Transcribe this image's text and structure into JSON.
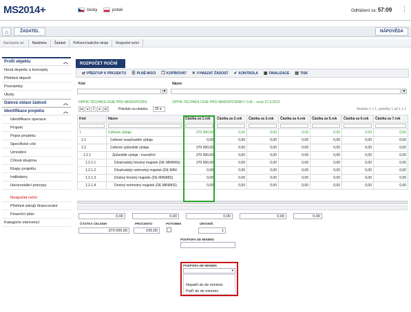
{
  "header": {
    "logo_main": "MS2014",
    "logo_plus": "+",
    "lang_cz": "česky",
    "lang_pl": "polski",
    "logout_label": "Odhlášení za:",
    "logout_time": "57:09"
  },
  "nav": {
    "applicant": "ŽADATEL",
    "help": "NÁPOVĚDA"
  },
  "breadcrumb": {
    "location_label": "Nacházíte se:",
    "items": [
      "Nástěnka",
      "Žadatel",
      "Pořízení balicího stroje",
      "Rozpočet roční"
    ]
  },
  "sidebar": {
    "h1": "Profil objektu",
    "items1": [
      "Nová depeše a koncepty",
      "Přehled depeší",
      "Poznámky",
      "Úkoly"
    ],
    "h2": "Datová oblast žádosti",
    "h3": "Identifikace projektu",
    "items3": [
      "Identifikace operace",
      "Projekt",
      "Popis projektu",
      "Specifické cíle",
      "Umístění",
      "Cílová skupina",
      "Etapy projektu",
      "Indikátory",
      "Horizontální principy"
    ],
    "active": "Rozpočet roční",
    "items4": [
      "Přehled zdrojů financování",
      "Finanční plán"
    ],
    "last": "Kategorie intervencí"
  },
  "main": {
    "tab": "ROZPOČET ROČNÍ",
    "toolbar": [
      "PŘESTUP K PROJEKTU",
      "PLNÉ MOCI",
      "KOPÍROVAT",
      "VYMAZAT ŽÁDOST",
      "KONTROLA",
      "FINALIZACE",
      "TISK"
    ],
    "col_kod": "Kód",
    "col_nazev": "Název",
    "prog_code": "OPPIK-TECHNOLOGIE PRO MIKROPODNI",
    "prog_name": "OPPIK-TECHNOLOGIE PRO MIKROPODNIKY O.M. - nový 27.9.2015",
    "pager_label": "Položek na stránku",
    "pager_value": "25",
    "pager_info": "Stránka 1 z 1, položky 1 až 1 z 1"
  },
  "table": {
    "headers": [
      "Kód",
      "Název",
      "Částka za 1.rok",
      "Částka za 2.rok",
      "Částka za 3.rok",
      "Částka za 4.rok",
      "Částka za 5.rok",
      "Částka za 6.rok",
      "Částka za 7.rok"
    ],
    "rows": [
      {
        "kod": "1",
        "nazev": "Celkové výdaje",
        "v": [
          "370 000,00",
          "0,00",
          "0,00",
          "0,00",
          "0,00",
          "0,00",
          "0,00"
        ]
      },
      {
        "kod": "1.1",
        "nazev": "Celkové nezpůsobilé výdaje",
        "v": [
          "0,00",
          "0,00",
          "0,00",
          "0,00",
          "0,00",
          "0,00",
          "0,00"
        ]
      },
      {
        "kod": "1.2",
        "nazev": "Celkové způsobilé výdaje",
        "v": [
          "370 000,00",
          "0,00",
          "0,00",
          "0,00",
          "0,00",
          "0,00",
          "0,00"
        ]
      },
      {
        "kod": "1.2.1",
        "nazev": "Způsobilé výdaje - investiční",
        "v": [
          "370 000,00",
          "0,00",
          "0,00",
          "0,00",
          "0,00",
          "0,00",
          "0,00"
        ]
      },
      {
        "kod": "1.2.1.1",
        "nazev": "Dlouhodobý hmotný majetek (DE MINIMIS)",
        "v": [
          "370 000,00",
          "0,00",
          "0,00",
          "0,00",
          "0,00",
          "0,00",
          "0,00"
        ]
      },
      {
        "kod": "1.2.1.2",
        "nazev": "Dlouhodobý nehmotný majetek (DE MINI",
        "v": [
          "0,00",
          "0,00",
          "0,00",
          "0,00",
          "0,00",
          "0,00",
          "0,00"
        ]
      },
      {
        "kod": "1.2.1.3",
        "nazev": "Drobný hmotný majetek (DE MINIMIS)",
        "v": [
          "0,00",
          "0,00",
          "0,00",
          "0,00",
          "0,00",
          "0,00",
          "0,00"
        ]
      },
      {
        "kod": "1.2.1.4",
        "nazev": "Drobný nehmotný majetek (DE MINIMIS)",
        "v": [
          "0,00",
          "0,00",
          "0,00",
          "0,00",
          "0,00",
          "0,00",
          "0,00"
        ]
      }
    ]
  },
  "form": {
    "row1": [
      "0,00",
      "0,00",
      "0,00",
      "0,00",
      "0,00"
    ],
    "total_label": "ČÁSTKA CELKEM",
    "total_value": "370 000,00",
    "pct_label": "PROCENTO",
    "pct_value": "100,00",
    "potomek_label": "POTOMEK",
    "uroven_label": "ÚROVEŇ",
    "uroven_value": "1",
    "minimis_label": "PODPORA DE MINIMIS"
  },
  "dropdown": {
    "label": "PODPORA DE MINIMIS",
    "options": [
      "Nepatří do de minimis",
      "Patří do de minimis"
    ]
  },
  "colors": {
    "primary": "#1f3a6e",
    "green": "#2aa42a",
    "red": "#cc1111"
  }
}
